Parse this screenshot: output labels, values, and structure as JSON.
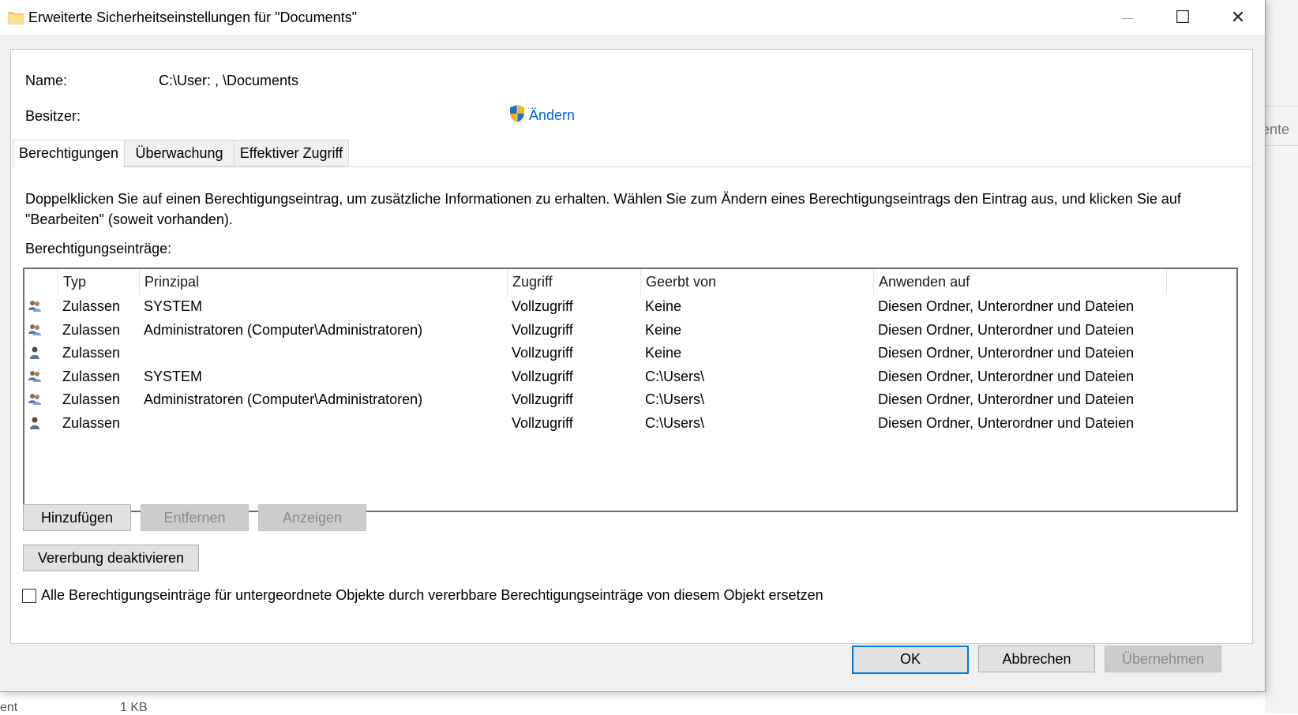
{
  "window": {
    "title": "Erweiterte Sicherheitseinstellungen für \"Documents\"",
    "minimize_glyph": "—",
    "maximize_glyph": "☐",
    "close_glyph": "✕"
  },
  "info": {
    "name_label": "Name:",
    "name_value": "C:\\User:  ,              \\Documents",
    "owner_label": "Besitzer:",
    "change_link": "Ändern"
  },
  "tabs": [
    {
      "label": "Berechtigungen",
      "active": true
    },
    {
      "label": "Überwachung",
      "active": false
    },
    {
      "label": "Effektiver Zugriff",
      "active": false
    }
  ],
  "permissions_tab": {
    "description": "Doppelklicken Sie auf einen Berechtigungseintrag, um zusätzliche Informationen zu erhalten. Wählen Sie zum Ändern eines Berechtigungseintrags den Eintrag aus, und klicken Sie auf \"Bearbeiten\" (soweit vorhanden).",
    "entries_label": "Berechtigungseinträge:",
    "columns": [
      "Typ",
      "Prinzipal",
      "Zugriff",
      "Geerbt von",
      "Anwenden auf"
    ],
    "rows": [
      {
        "icon": "group-icon",
        "type": "Zulassen",
        "principal": "SYSTEM",
        "access": "Vollzugriff",
        "inherited": "Keine",
        "applies": "Diesen Ordner, Unterordner und Dateien"
      },
      {
        "icon": "group-icon",
        "type": "Zulassen",
        "principal": "Administratoren (Computer\\Administratoren)",
        "access": "Vollzugriff",
        "inherited": "Keine",
        "applies": "Diesen Ordner, Unterordner und Dateien"
      },
      {
        "icon": "user-icon",
        "type": "Zulassen",
        "principal": "",
        "access": "Vollzugriff",
        "inherited": "Keine",
        "applies": "Diesen Ordner, Unterordner und Dateien"
      },
      {
        "icon": "group-icon",
        "type": "Zulassen",
        "principal": "SYSTEM",
        "access": "Vollzugriff",
        "inherited": "C:\\Users\\",
        "applies": "Diesen Ordner, Unterordner und Dateien"
      },
      {
        "icon": "group-icon",
        "type": "Zulassen",
        "principal": "Administratoren (Computer\\Administratoren)",
        "access": "Vollzugriff",
        "inherited": "C:\\Users\\",
        "applies": "Diesen Ordner, Unterordner und Dateien"
      },
      {
        "icon": "user-icon",
        "type": "Zulassen",
        "principal": "",
        "access": "Vollzugriff",
        "inherited": "C:\\Users\\",
        "applies": "Diesen Ordner, Unterordner und Dateien"
      }
    ],
    "add_button": "Hinzufügen",
    "remove_button": "Entfernen",
    "view_button": "Anzeigen",
    "disable_inheritance_button": "Vererbung deaktivieren",
    "replace_checkbox_label": "Alle Berechtigungseinträge für untergeordnete Objekte durch vererbbare Berechtigungseinträge von diesem Objekt ersetzen",
    "replace_checked": false
  },
  "footer": {
    "ok_button": "OK",
    "cancel_button": "Abbrechen",
    "apply_button": "Übernehmen"
  },
  "background": {
    "right_text": "ente",
    "bottom_left_text": "ent",
    "bottom_size_text": "1 KB"
  },
  "colors": {
    "link": "#0066cc",
    "default_button_border": "#0078d7",
    "disabled_text": "#8a8a8a"
  }
}
